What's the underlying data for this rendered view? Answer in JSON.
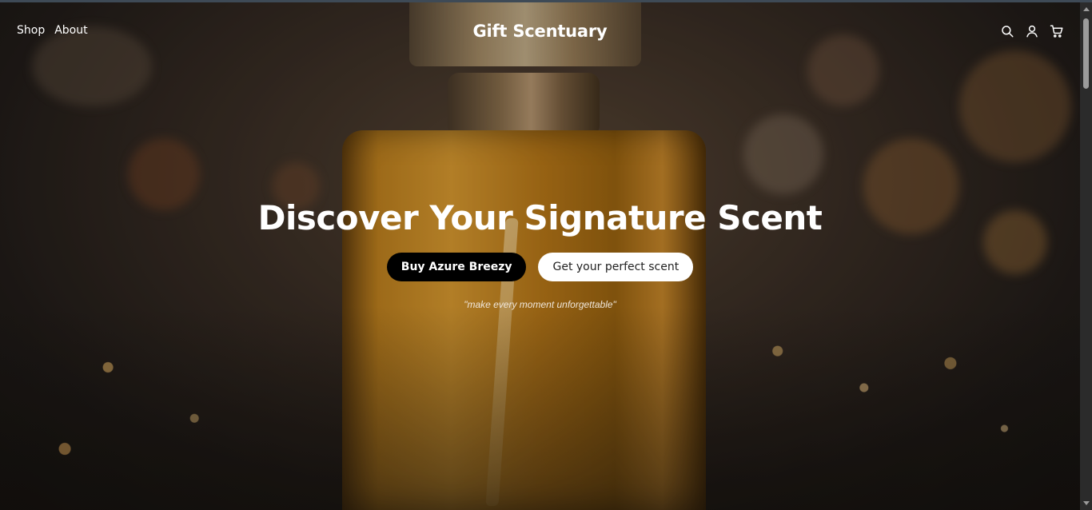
{
  "nav": {
    "links": [
      "Shop",
      "About"
    ],
    "brand": "Gift Scentuary",
    "icons": [
      "search-icon",
      "user-icon",
      "cart-icon"
    ]
  },
  "hero": {
    "headline": "Discover Your Signature Scent",
    "primary_cta": "Buy Azure Breezy",
    "secondary_cta": "Get your perfect scent",
    "tagline": "\"make every moment unforgettable\""
  },
  "colors": {
    "primary_button": "#000000",
    "secondary_button": "#ffffff",
    "text": "#ffffff"
  }
}
